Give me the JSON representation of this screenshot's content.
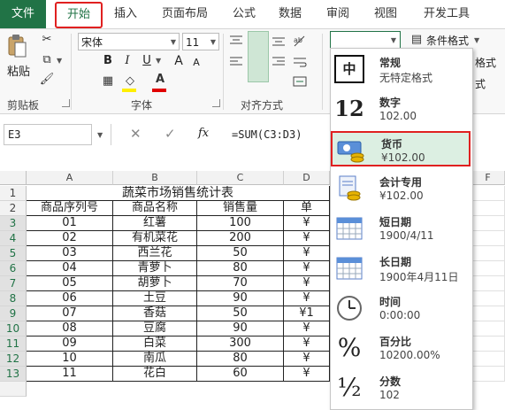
{
  "tabs": {
    "file": "文件",
    "home": "开始",
    "insert": "插入",
    "page_layout": "页面布局",
    "formulas": "公式",
    "data": "数据",
    "review": "审阅",
    "view": "视图",
    "developer": "开发工具"
  },
  "ribbon": {
    "clipboard": {
      "paste": "粘贴",
      "group": "剪贴板"
    },
    "font": {
      "name": "宋体",
      "size": "11",
      "bold": "B",
      "italic": "I",
      "underline": "U",
      "grow": "A",
      "shrink": "A",
      "group": "字体"
    },
    "alignment": {
      "group": "对齐方式"
    },
    "styles": {
      "conditional": "条件格式",
      "partial_1": "格式",
      "partial_2": "式"
    }
  },
  "formula_bar": {
    "name_box": "E3",
    "fx": "fx",
    "formula": "=SUM(C3:D3)"
  },
  "grid": {
    "columns": [
      "A",
      "B",
      "C",
      "D",
      "F"
    ],
    "rows": [
      "1",
      "2",
      "3",
      "4",
      "5",
      "6",
      "7",
      "8",
      "9",
      "10",
      "11",
      "12",
      "13"
    ],
    "title": "蔬菜市场销售统计表",
    "headers": [
      "商品序列号",
      "商品名称",
      "销售量",
      "单"
    ],
    "data": [
      [
        "01",
        "红薯",
        "100",
        "¥"
      ],
      [
        "02",
        "有机菜花",
        "200",
        "¥"
      ],
      [
        "03",
        "西兰花",
        "50",
        "¥"
      ],
      [
        "04",
        "青萝卜",
        "80",
        "¥"
      ],
      [
        "05",
        "胡萝卜",
        "70",
        "¥"
      ],
      [
        "06",
        "土豆",
        "90",
        "¥"
      ],
      [
        "07",
        "香菇",
        "50",
        "¥1"
      ],
      [
        "08",
        "豆腐",
        "90",
        "¥"
      ],
      [
        "09",
        "白菜",
        "300",
        "¥"
      ],
      [
        "10",
        "南瓜",
        "80",
        "¥"
      ],
      [
        "11",
        "花白",
        "60",
        "¥"
      ]
    ]
  },
  "number_format_menu": [
    {
      "title": "常规",
      "value": "无特定格式",
      "icon": "general-icon",
      "glyph": "中"
    },
    {
      "title": "数字",
      "value": "102.00",
      "icon": "number-icon",
      "glyph": "12"
    },
    {
      "title": "货币",
      "value": "¥102.00",
      "icon": "currency-icon",
      "glyph": ""
    },
    {
      "title": "会计专用",
      "value": "¥102.00",
      "icon": "accounting-icon",
      "glyph": ""
    },
    {
      "title": "短日期",
      "value": "1900/4/11",
      "icon": "short-date-icon",
      "glyph": ""
    },
    {
      "title": "长日期",
      "value": "1900年4月11日",
      "icon": "long-date-icon",
      "glyph": ""
    },
    {
      "title": "时间",
      "value": "0:00:00",
      "icon": "clock-icon",
      "glyph": ""
    },
    {
      "title": "百分比",
      "value": "10200.00%",
      "icon": "percent-icon",
      "glyph": "%"
    },
    {
      "title": "分数",
      "value": "102",
      "icon": "fraction-icon",
      "glyph": "½"
    }
  ],
  "colors": {
    "excel_green": "#217346",
    "highlight_red": "#e02020",
    "selected_fill": "#dcefe2"
  }
}
